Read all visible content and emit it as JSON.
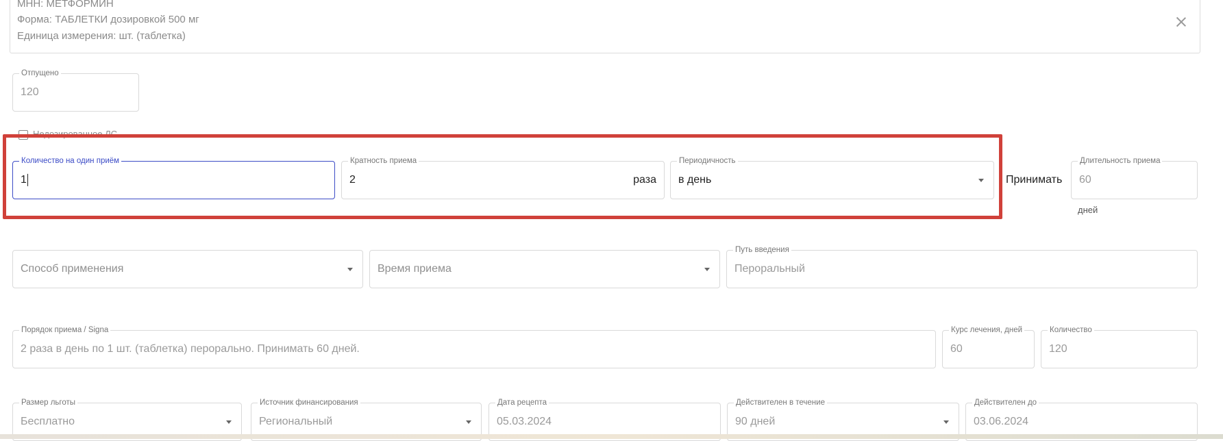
{
  "drug_info": {
    "mnn": "МНН: МЕТФОРМИН",
    "form": "Форма: ТАБЛЕТКИ дозировкой 500 мг",
    "unit": "Единица измерения: шт. (таблетка)"
  },
  "dispensed": {
    "label": "Отпущено",
    "value": "120"
  },
  "checkbox_label": "Недозированное ЛС",
  "dose_row": {
    "quantity": {
      "label": "Количество на один приём",
      "value": "1"
    },
    "frequency": {
      "label": "Кратность приема",
      "value": "2",
      "suffix": "раза"
    },
    "periodicity": {
      "label": "Периодичность",
      "value": "в день"
    },
    "take_label": "Принимать",
    "duration": {
      "label": "Длительность приема",
      "value": "60",
      "unit": "дней"
    }
  },
  "method": {
    "placeholder": "Способ применения"
  },
  "intake_time": {
    "placeholder": "Время приема"
  },
  "route": {
    "label": "Путь введения",
    "value": "Пероральный"
  },
  "signa": {
    "label": "Порядок приема / Signa",
    "value": "2 раза в день по 1 шт. (таблетка) перорально. Принимать 60 дней."
  },
  "course": {
    "label": "Курс лечения, дней",
    "value": "60"
  },
  "amount": {
    "label": "Количество",
    "value": "120"
  },
  "benefit": {
    "label": "Размер льготы",
    "value": "Бесплатно"
  },
  "funding": {
    "label": "Источник финансирования",
    "value": "Региональный"
  },
  "rx_date": {
    "label": "Дата рецепта",
    "value": "05.03.2024"
  },
  "valid_for": {
    "label": "Действителен в течение",
    "value": "90 дней"
  },
  "valid_until": {
    "label": "Действителен до",
    "value": "03.06.2024"
  },
  "colors": {
    "focus": "#3b4bc6",
    "highlight": "#d0413a",
    "border": "#d9d9d9"
  }
}
